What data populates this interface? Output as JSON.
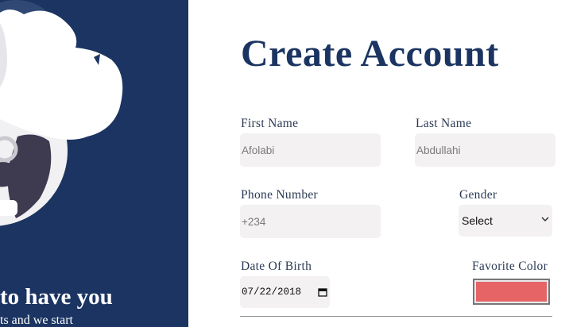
{
  "welcome": {
    "heading": "to have you",
    "subtext": "ts and we start"
  },
  "form": {
    "title": "Create Account",
    "first_name": {
      "label": "First Name",
      "placeholder": "Afolabi"
    },
    "last_name": {
      "label": "Last Name",
      "placeholder": "Abdullahi"
    },
    "phone": {
      "label": "Phone Number",
      "placeholder": "+234"
    },
    "gender": {
      "label": "Gender",
      "selected": "Select"
    },
    "dob": {
      "label": "Date Of Birth",
      "value": "07/22/2018"
    },
    "favorite_color": {
      "label": "Favorite Color",
      "value": "#e66465"
    }
  },
  "colors": {
    "panel_bg": "#1b3461",
    "title": "#1b3461",
    "input_bg": "#f3f1f2"
  },
  "icons": [
    "chevron-down-icon",
    "calendar-icon"
  ]
}
